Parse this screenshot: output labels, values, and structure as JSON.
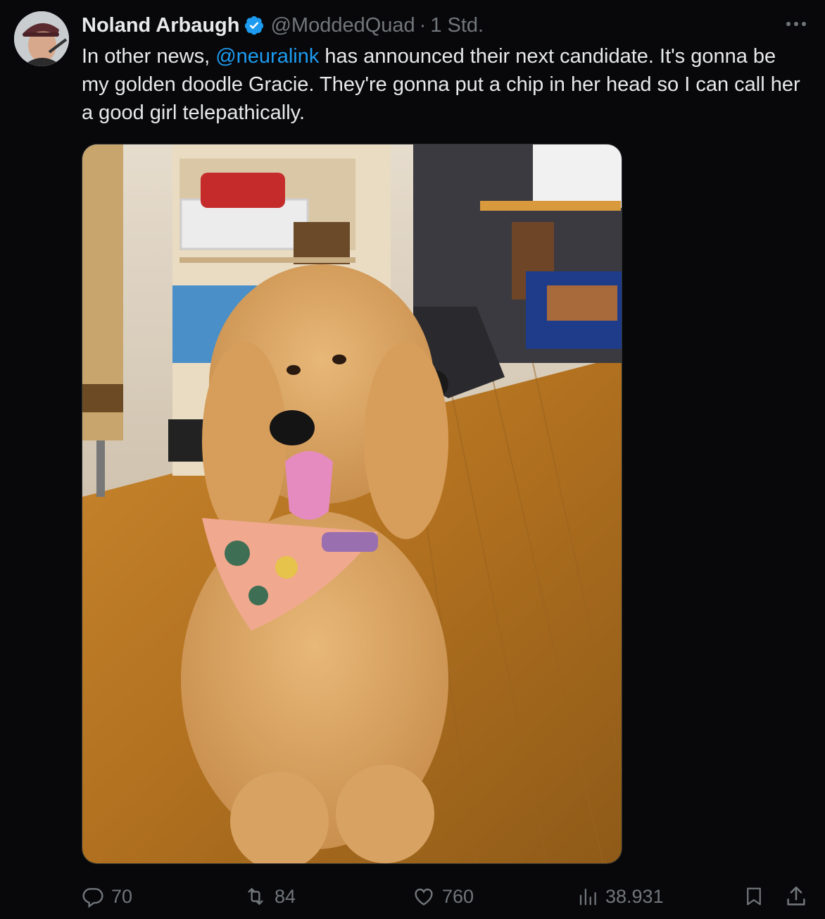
{
  "author": {
    "display_name": "Noland Arbaugh",
    "handle": "@ModdedQuad",
    "separator": "·",
    "time": "1 Std."
  },
  "tweet": {
    "text_before": "In other news, ",
    "mention": "@neuralink",
    "text_after": " has announced their next candidate. It's gonna be my golden doodle Gracie. They're gonna put a chip in her head so I can call her a good girl telepathically."
  },
  "actions": {
    "replies": "70",
    "reposts": "84",
    "likes": "760",
    "views": "38.931"
  },
  "icons": {
    "verified": "verified-badge-icon",
    "more": "more-options-icon",
    "reply": "reply-icon",
    "repost": "repost-icon",
    "like": "heart-icon",
    "views": "views-chart-icon",
    "bookmark": "bookmark-icon",
    "share": "share-icon"
  },
  "colors": {
    "background": "#08080a",
    "text": "#e7e9ea",
    "muted": "#71767b",
    "accent": "#1d9bf0"
  }
}
